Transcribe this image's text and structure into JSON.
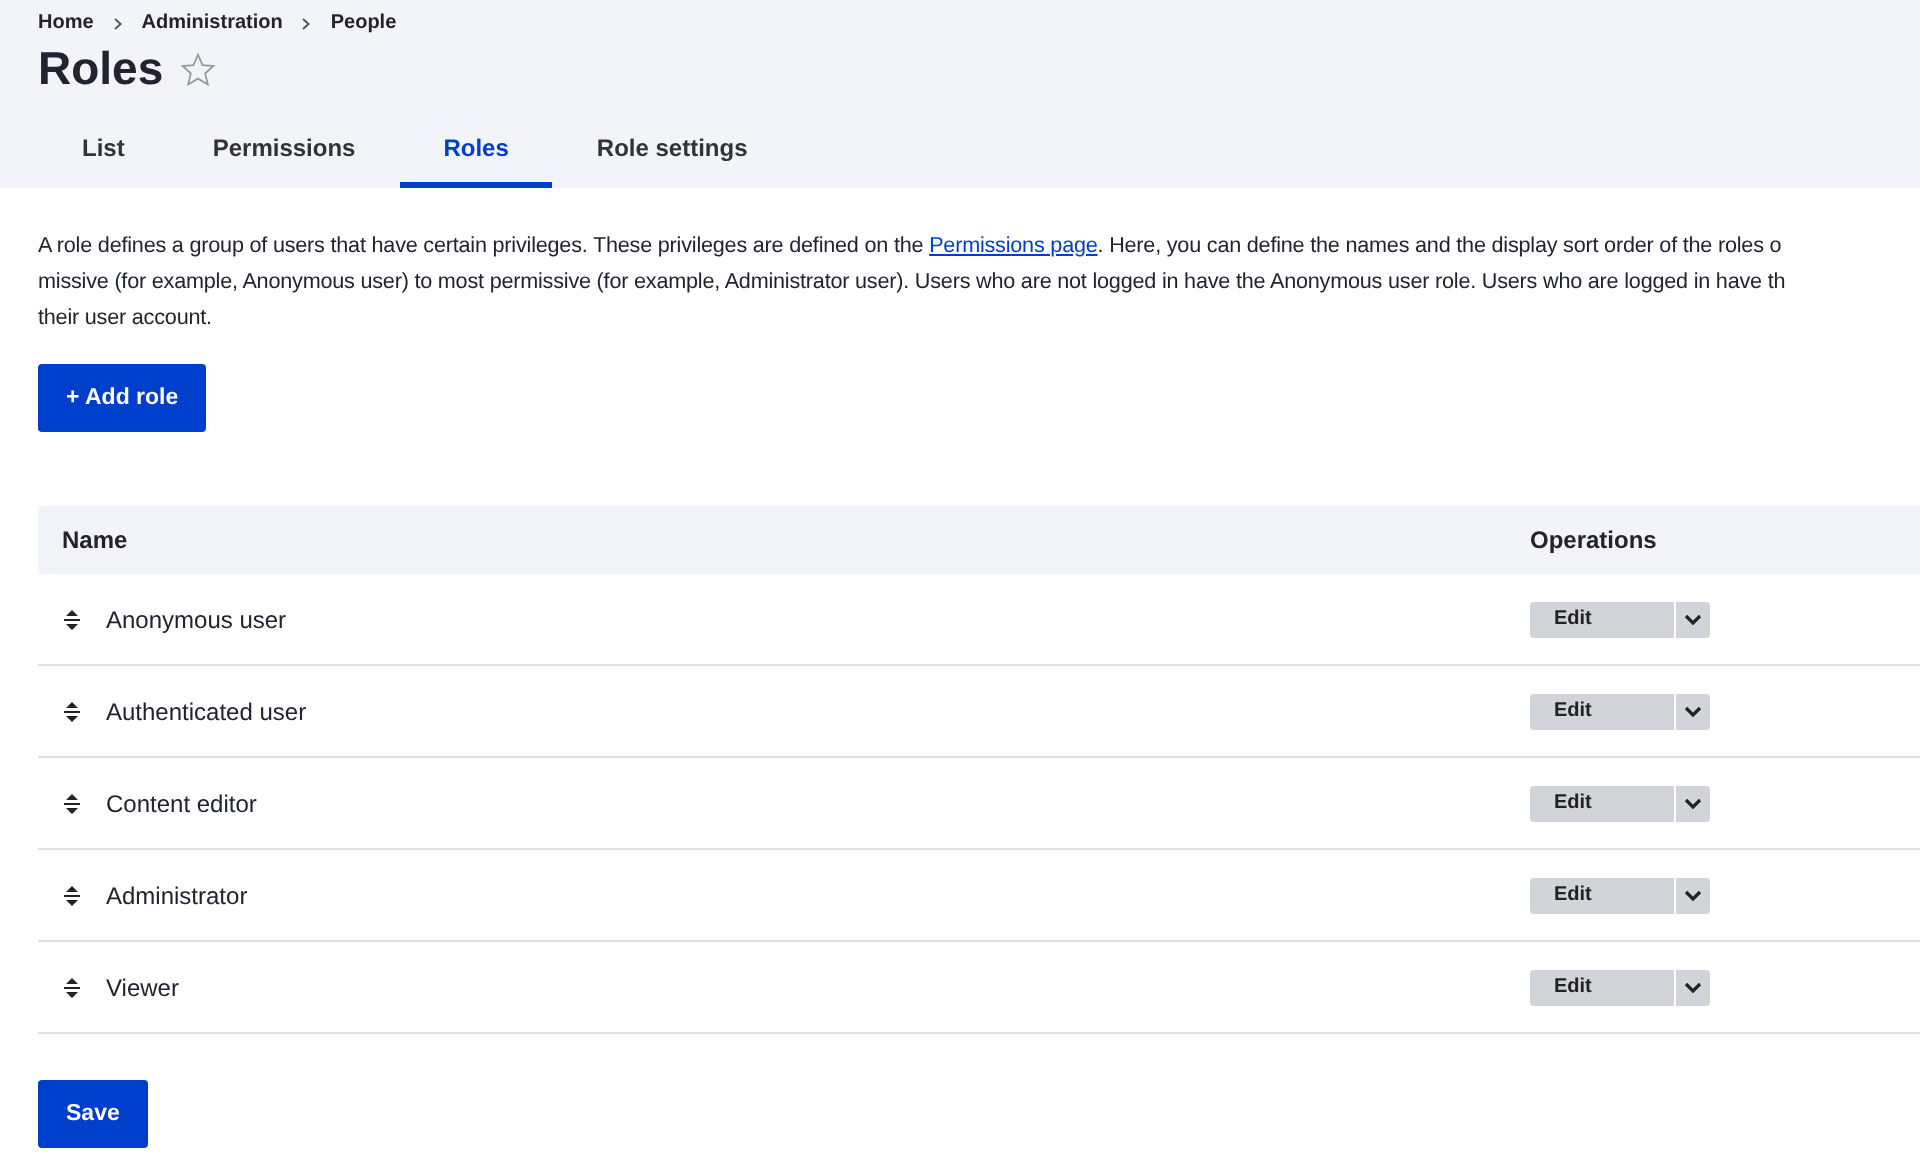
{
  "breadcrumb": [
    "Home",
    "Administration",
    "People"
  ],
  "title": "Roles",
  "favorite": false,
  "tabs": [
    {
      "label": "List",
      "selected": false
    },
    {
      "label": "Permissions",
      "selected": false
    },
    {
      "label": "Roles",
      "selected": true
    },
    {
      "label": "Role settings",
      "selected": false
    }
  ],
  "description": {
    "line_1_before": "A role defines a group of users that have certain privileges. These privileges are defined on the",
    "link": "Permissions page",
    "line_1_after": ". Here, you can define the names and the display sort order of the roles o",
    "line_2": "missive (for example, Anonymous user) to most permissive (for example, Administrator user). Users who are not logged in have the Anonymous user role. Users who are logged in have th",
    "line_3": "their user account."
  },
  "add_button": "+ Add role",
  "table": {
    "columns": [
      "Name",
      "Operations"
    ],
    "rows": [
      {
        "name": "Anonymous user",
        "operation": "Edit"
      },
      {
        "name": "Authenticated user",
        "operation": "Edit"
      },
      {
        "name": "Content editor",
        "operation": "Edit"
      },
      {
        "name": "Administrator",
        "operation": "Edit"
      },
      {
        "name": "Viewer",
        "operation": "Edit"
      }
    ]
  },
  "save_button": "Save"
}
